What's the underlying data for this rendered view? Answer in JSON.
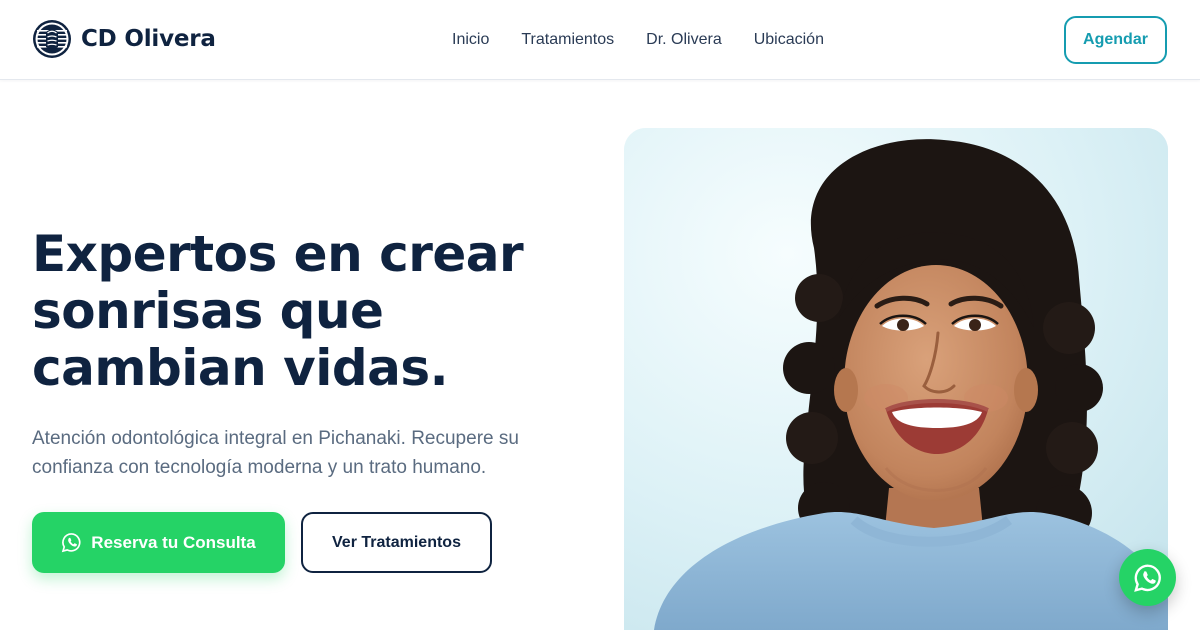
{
  "brand": {
    "name": "CD Olivera",
    "logo_icon": "striped-globe-logo",
    "colors": {
      "navy": "#0f2340",
      "teal": "#159cb0",
      "whatsapp": "#25d366",
      "muted": "#5a6b80"
    }
  },
  "nav": {
    "items": [
      {
        "label": "Inicio"
      },
      {
        "label": "Tratamientos"
      },
      {
        "label": "Dr. Olivera"
      },
      {
        "label": "Ubicación"
      }
    ],
    "cta_label": "Agendar"
  },
  "hero": {
    "title_lines": [
      "Expertos en crear",
      "sonrisas que",
      "cambian vidas."
    ],
    "subtitle_lines": [
      "Atención odontológica integral en Pichanaki. Recupere su",
      "confianza con tecnología moderna y un trato humano."
    ],
    "primary_button": {
      "label": "Reserva tu Consulta",
      "icon": "whatsapp-icon"
    },
    "secondary_button": {
      "label": "Ver Tratamientos"
    },
    "image": {
      "subject": "smiling woman with curly dark hair in a light blue sweater"
    }
  },
  "floating_button": {
    "icon": "whatsapp-icon"
  }
}
